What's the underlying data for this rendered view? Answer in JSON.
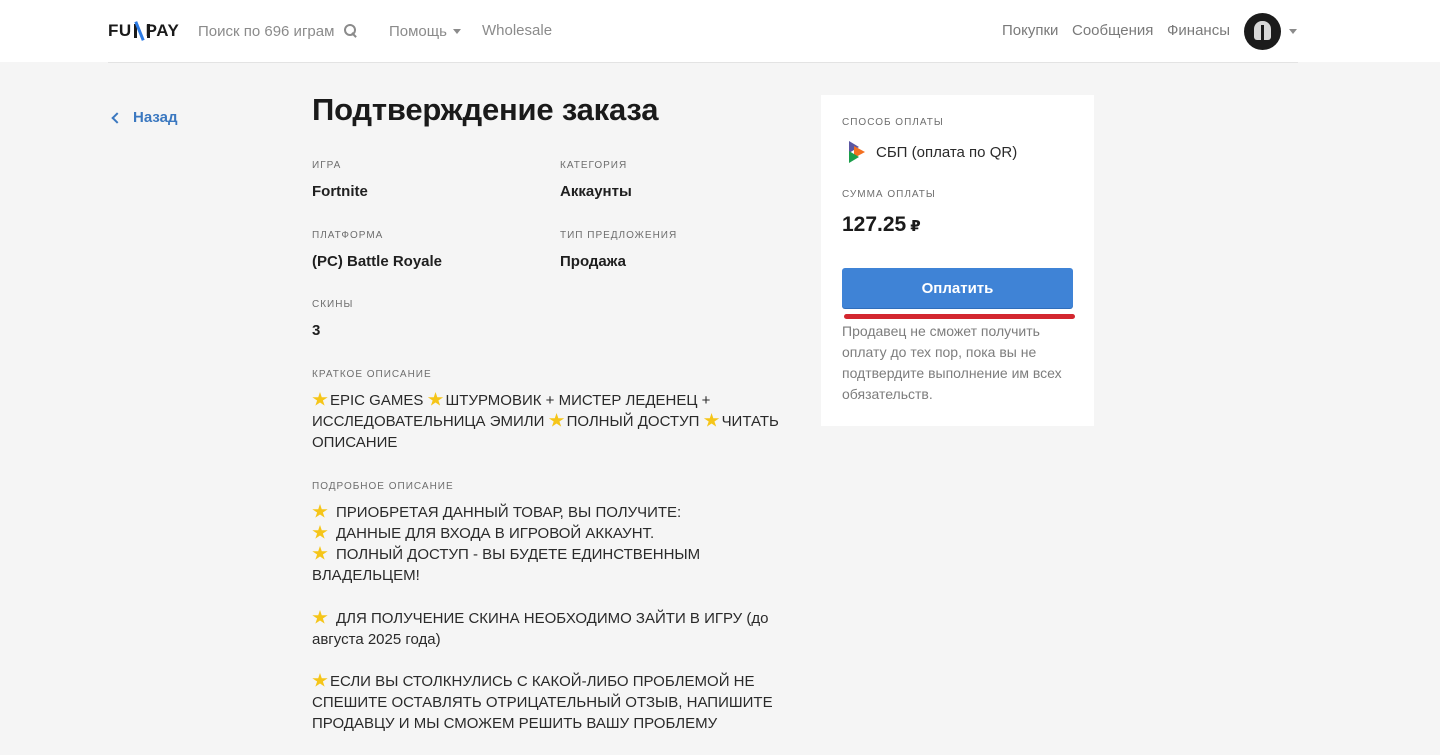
{
  "header": {
    "logo": "FUNPAY",
    "logo_left": "FU",
    "logo_right": "PAY",
    "search_label": "Поиск по 696 играм",
    "help_label": "Помощь",
    "wholesale_label": "Wholesale",
    "purchases_label": "Покупки",
    "messages_label": "Сообщения",
    "finance_label": "Финансы"
  },
  "back_label": "Назад",
  "page_title": "Подтверждение заказа",
  "fields": {
    "game_label": "ИГРА",
    "game_value": "Fortnite",
    "category_label": "КАТЕГОРИЯ",
    "category_value": "Аккаунты",
    "platform_label": "ПЛАТФОРМА",
    "platform_value": "(PC) Battle Royale",
    "offer_type_label": "ТИП ПРЕДЛОЖЕНИЯ",
    "offer_type_value": "Продажа",
    "skins_label": "СКИНЫ",
    "skins_value": "3"
  },
  "short_desc": {
    "label": "КРАТКОЕ ОПИСАНИЕ",
    "part1": "EPIC GAMES",
    "part2": "ШТУРМОВИК + МИСТЕР ЛЕДЕНЕЦ + ИССЛЕДОВАТЕЛЬНИЦА ЭМИЛИ",
    "part3": "ПОЛНЫЙ ДОСТУП",
    "part4": "ЧИТАТЬ ОПИСАНИЕ"
  },
  "full_desc": {
    "label": "ПОДРОБНОЕ ОПИСАНИЕ",
    "line1": "ПРИОБРЕТАЯ ДАННЫЙ ТОВАР, ВЫ ПОЛУЧИТЕ:",
    "line2": "ДАННЫЕ ДЛЯ ВХОДА В ИГРОВОЙ АККАУНТ.",
    "line3": "ПОЛНЫЙ ДОСТУП - ВЫ БУДЕТЕ ЕДИНСТВЕННЫМ ВЛАДЕЛЬЦЕМ!",
    "line4": "ДЛЯ ПОЛУЧЕНИЕ СКИНА НЕОБХОДИМО ЗАЙТИ В ИГРУ (до августа 2025 года)",
    "line5": "ЕСЛИ ВЫ СТОЛКНУЛИСЬ С КАКОЙ-ЛИБО ПРОБЛЕМОЙ НЕ СПЕШИТЕ ОСТАВЛЯТЬ ОТРИЦАТЕЛЬНЫЙ ОТЗЫВ, НАПИШИТЕ ПРОДАВЦУ И МЫ СМОЖЕМ РЕШИТЬ ВАШУ ПРОБЛЕМУ"
  },
  "payment": {
    "method_label": "СПОСОБ ОПЛАТЫ",
    "method_value": "СБП (оплата по QR)",
    "sum_label": "СУММА ОПЛАТЫ",
    "sum_value": "127.25",
    "currency": "₽",
    "pay_button": "Оплатить",
    "note": "Продавец не сможет получить оплату до тех пор, пока вы не подтвердите выполнение им всех обязательств."
  },
  "colors": {
    "accent": "#3f83d6",
    "link": "#3b78c0",
    "highlight_underline": "#d3272f",
    "star": "#f5c518"
  },
  "icons": [
    "search-icon",
    "chevron-down-icon",
    "chevron-left-icon",
    "star-icon",
    "sbp-logo-icon",
    "avatar"
  ]
}
